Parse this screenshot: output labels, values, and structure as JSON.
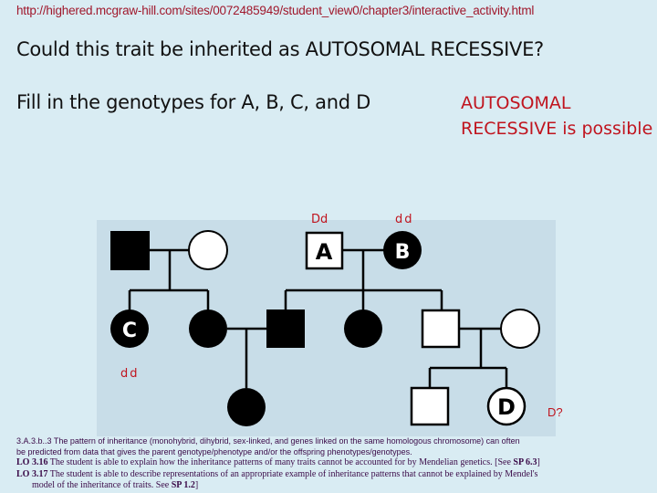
{
  "url": "http://highered.mcgraw-hill.com/sites/0072485949/student_view0/chapter3/interactive_activity.html",
  "question": "Could this trait be inherited as AUTOSOMAL RECESSIVE?",
  "instruction": "Fill in the genotypes for A, B, C, and D",
  "answer": {
    "line1": "AUTOSOMAL",
    "line2": "RECESSIVE is possible"
  },
  "colors": {
    "background": "#d9ecf3",
    "pedigree_panel": "#c8dde8",
    "answer_red": "#c0141e",
    "url_red": "#a0182c",
    "affected": "#000000",
    "unaffected": "#ffffff"
  },
  "pedigree": {
    "individuals": [
      {
        "id": "g1-male",
        "generation": 1,
        "sex": "male",
        "affected": true,
        "label": ""
      },
      {
        "id": "g1-female",
        "generation": 1,
        "sex": "female",
        "affected": false,
        "label": ""
      },
      {
        "id": "A",
        "generation": 1,
        "sex": "male",
        "affected": false,
        "label": "A",
        "genotype": "Dd"
      },
      {
        "id": "B",
        "generation": 1,
        "sex": "female",
        "affected": true,
        "label": "B",
        "genotype": "dd"
      },
      {
        "id": "C",
        "generation": 2,
        "sex": "female",
        "affected": true,
        "label": "C",
        "genotype": "dd"
      },
      {
        "id": "g2-female-2",
        "generation": 2,
        "sex": "female",
        "affected": true,
        "label": ""
      },
      {
        "id": "g2-male-1",
        "generation": 2,
        "sex": "male",
        "affected": true,
        "label": ""
      },
      {
        "id": "g2-female-3",
        "generation": 2,
        "sex": "female",
        "affected": true,
        "label": ""
      },
      {
        "id": "g2-male-2",
        "generation": 2,
        "sex": "male",
        "affected": false,
        "label": ""
      },
      {
        "id": "g2-female-4",
        "generation": 2,
        "sex": "female",
        "affected": false,
        "label": ""
      },
      {
        "id": "g3-female-1",
        "generation": 3,
        "sex": "female",
        "affected": true,
        "label": ""
      },
      {
        "id": "g3-male-1",
        "generation": 3,
        "sex": "male",
        "affected": false,
        "label": ""
      },
      {
        "id": "D",
        "generation": 3,
        "sex": "female",
        "affected": false,
        "label": "D",
        "genotype": "D?"
      }
    ],
    "genotype_labels": {
      "A": "Dd",
      "B": "dd",
      "C": "dd",
      "D": "D?"
    }
  },
  "footer": {
    "line1": "3.A.3.b..3 The pattern of inheritance (monohybrid, dihybrid, sex-linked, and genes linked on the same homologous chromosome) can often",
    "line2": "be predicted from data that gives the parent genotype/phenotype and/or the offspring phenotypes/genotypes.",
    "lo316_code": "LO 3.16",
    "lo316_text": " The student is able to explain how the inheritance patterns of many traits cannot be accounted for by Mendelian genetics. [See ",
    "lo316_sp": "SP 6.3",
    "lo316_end": "]",
    "lo317_code": "LO 3.17",
    "lo317_text": " The student is able to describe representations of an appropriate example of inheritance patterns that cannot be explained by Mendel's",
    "lo317_cont": "model of the inheritance of traits. See ",
    "lo317_sp": "SP 1.2",
    "lo317_end": "]"
  }
}
